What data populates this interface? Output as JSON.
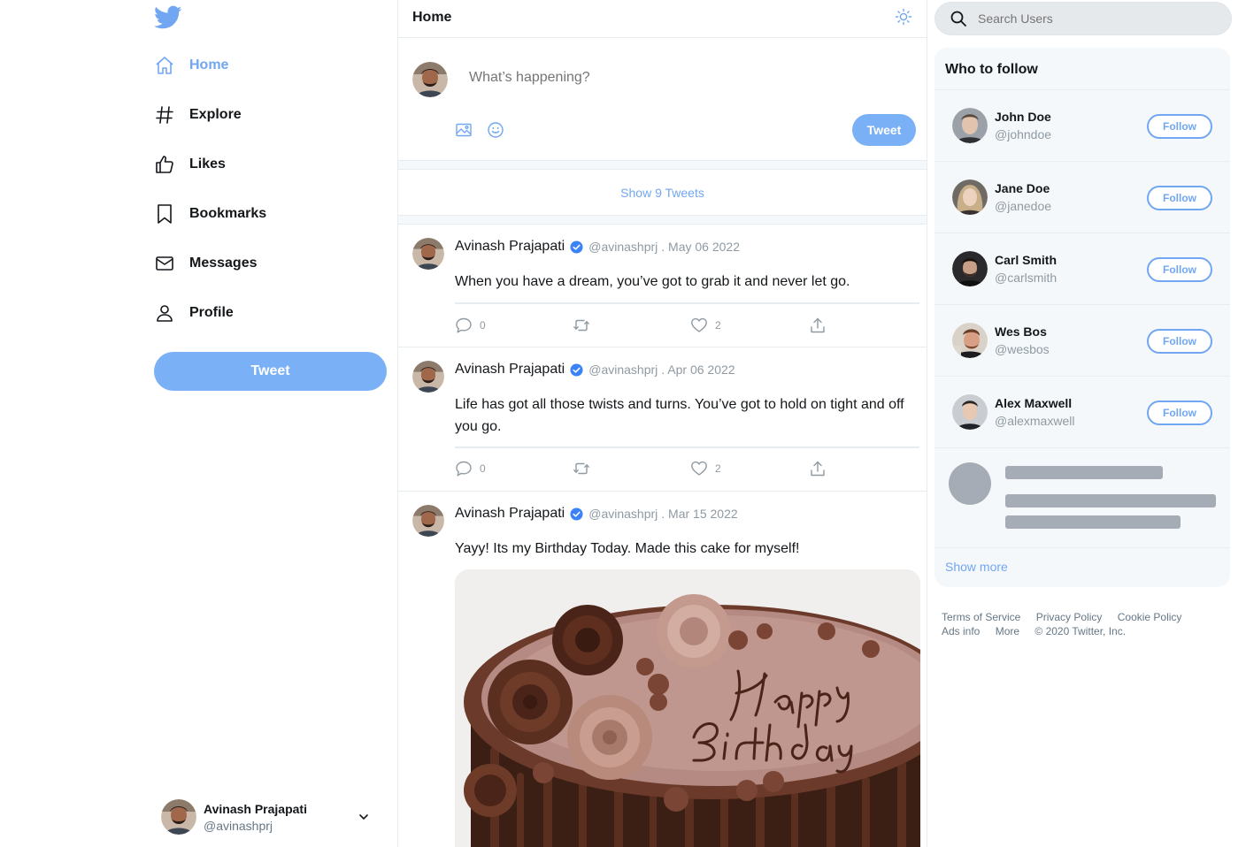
{
  "nav": {
    "items": [
      {
        "label": "Home",
        "icon": "home-icon",
        "active": true
      },
      {
        "label": "Explore",
        "icon": "hashtag-icon"
      },
      {
        "label": "Likes",
        "icon": "thumbs-up-icon"
      },
      {
        "label": "Bookmarks",
        "icon": "bookmark-icon"
      },
      {
        "label": "Messages",
        "icon": "envelope-icon"
      },
      {
        "label": "Profile",
        "icon": "user-icon"
      }
    ],
    "tweet_button": "Tweet"
  },
  "current_user": {
    "name": "Avinash Prajapati",
    "handle": "@avinashprj"
  },
  "header": {
    "title": "Home"
  },
  "compose": {
    "placeholder": "What’s happening?",
    "tweet_button": "Tweet"
  },
  "show_tweets": "Show 9 Tweets",
  "tweets": [
    {
      "name": "Avinash Prajapati",
      "handle": "@avinashprj",
      "date": ". May 06 2022",
      "text": "When you have a dream, you’ve got to grab it and never let go.",
      "replies": "0",
      "likes": "2"
    },
    {
      "name": "Avinash Prajapati",
      "handle": "@avinashprj",
      "date": ". Apr 06 2022",
      "text": "Life has got all those twists and turns. You’ve got to hold on tight and off you go.",
      "replies": "0",
      "likes": "2"
    },
    {
      "name": "Avinash Prajapati",
      "handle": "@avinashprj",
      "date": ". Mar 15 2022",
      "text": "Yayy! Its my Birthday Today. Made this cake for myself!",
      "image": "birthday-cake-photo"
    }
  ],
  "search": {
    "placeholder": "Search Users"
  },
  "who_to_follow": {
    "title": "Who to follow",
    "users": [
      {
        "name": "John Doe",
        "handle": "@johndoe",
        "button": "Follow"
      },
      {
        "name": "Jane Doe",
        "handle": "@janedoe",
        "button": "Follow"
      },
      {
        "name": "Carl Smith",
        "handle": "@carlsmith",
        "button": "Follow"
      },
      {
        "name": "Wes Bos",
        "handle": "@wesbos",
        "button": "Follow"
      },
      {
        "name": "Alex Maxwell",
        "handle": "@alexmaxwell",
        "button": "Follow"
      }
    ],
    "show_more": "Show more"
  },
  "footer": {
    "links": [
      "Terms of Service",
      "Privacy Policy",
      "Cookie Policy",
      "Ads info",
      "More"
    ],
    "copyright": "© 2020 Twitter, Inc."
  },
  "colors": {
    "accent": "#71a7f2",
    "button": "#7ab0f5",
    "border": "#e6ecf0",
    "muted": "#8f9aa3"
  }
}
